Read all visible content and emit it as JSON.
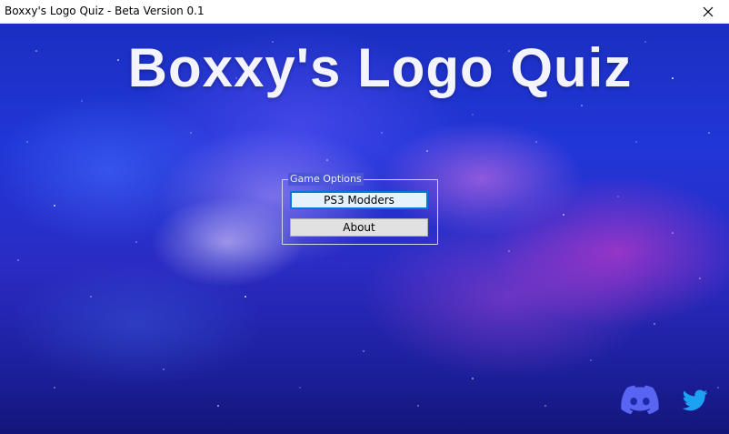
{
  "window": {
    "title": "Boxxy's Logo Quiz - Beta Version 0.1",
    "close_icon": "close-icon"
  },
  "main": {
    "heading": "Boxxy's Logo Quiz",
    "game_options": {
      "legend": "Game Options",
      "buttons": [
        {
          "label": "PS3 Modders",
          "focused": true
        },
        {
          "label": "About",
          "focused": false
        }
      ]
    },
    "social": [
      {
        "icon": "discord-icon",
        "color": "#5865f2"
      },
      {
        "icon": "twitter-icon",
        "color": "#1da1f2"
      }
    ]
  },
  "colors": {
    "focus_border": "#0078d7",
    "button_face": "#e1e1e1",
    "heading_text": "#f4f4ff"
  }
}
